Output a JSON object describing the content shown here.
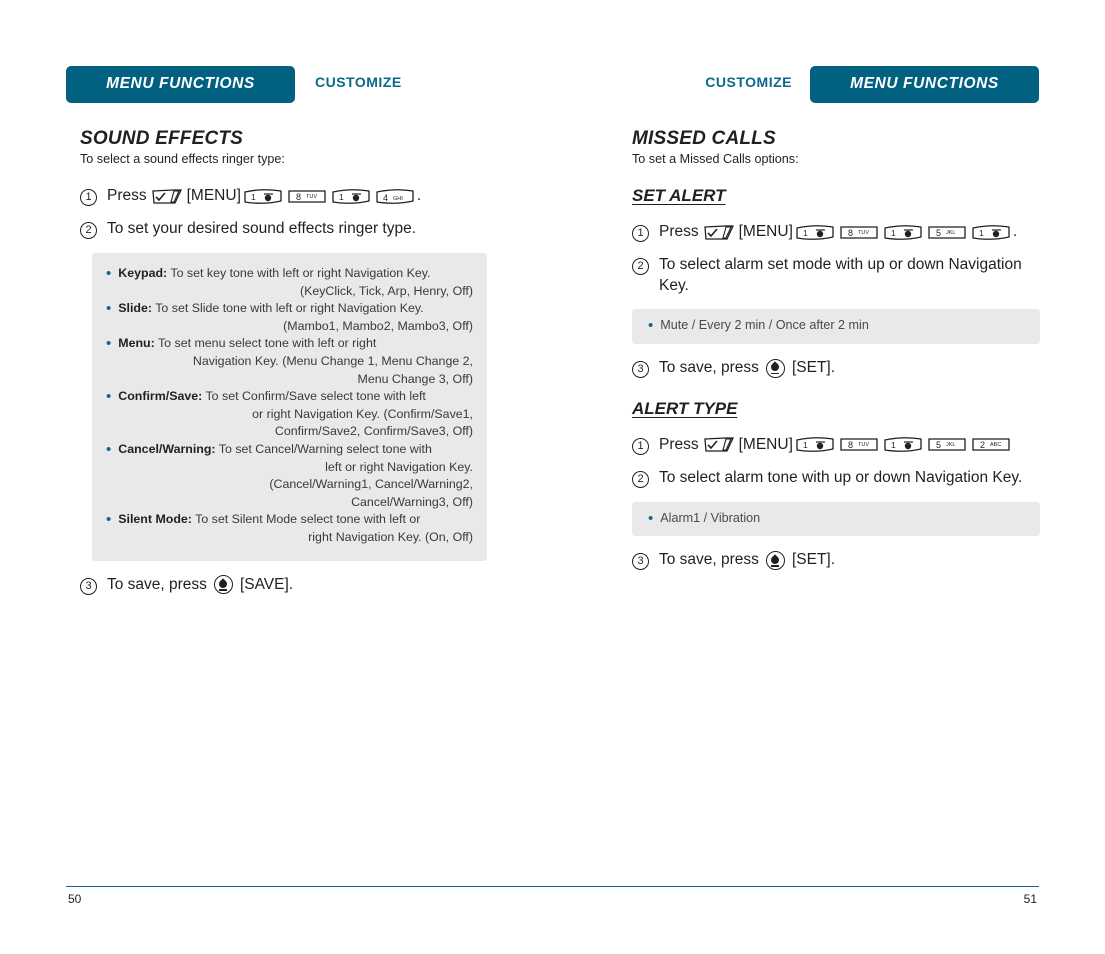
{
  "left_page": {
    "badge": "MENU FUNCTIONS",
    "section_tag": "CUSTOMIZE",
    "title": "SOUND EFFECTS",
    "lead": "To select a sound effects ringer type:",
    "step1": {
      "num": "1",
      "press_label": "Press",
      "menu_label": "[MENU]",
      "period": "."
    },
    "step1_keys": [
      {
        "digit": "1",
        "letters": ""
      },
      {
        "digit": "8",
        "letters": "TUV"
      },
      {
        "digit": "1",
        "letters": ""
      },
      {
        "digit": "4",
        "letters": "GHI"
      }
    ],
    "step2": {
      "num": "2",
      "text": "To set your desired sound effects ringer type."
    },
    "options": [
      {
        "term": "Keypad:",
        "text": "To set key tone with left or right Navigation Key.",
        "cont": [
          "(KeyClick, Tick, Arp, Henry, Off)"
        ]
      },
      {
        "term": "Slide:",
        "text": "To set Slide tone with left or right Navigation Key.",
        "cont": [
          "(Mambo1, Mambo2, Mambo3, Off)"
        ]
      },
      {
        "term": "Menu:",
        "text": "To set menu select tone with left or right",
        "cont": [
          "Navigation Key. (Menu Change 1, Menu Change 2,",
          "Menu Change 3, Off)"
        ]
      },
      {
        "term": "Confirm/Save:",
        "text": "To set Confirm/Save select tone with left",
        "cont": [
          "or right Navigation Key. (Confirm/Save1,",
          "Confirm/Save2, Confirm/Save3, Off)"
        ]
      },
      {
        "term": "Cancel/Warning:",
        "text": "To set Cancel/Warning select tone with",
        "cont": [
          "left or right Navigation Key.",
          "(Cancel/Warning1, Cancel/Warning2,",
          "Cancel/Warning3, Off)"
        ]
      },
      {
        "term": "Silent Mode:",
        "text": "To set Silent Mode select tone with left or",
        "cont": [
          "right Navigation Key. (On, Off)"
        ]
      }
    ],
    "step3": {
      "num": "3",
      "text_before": "To save, press",
      "text_after": "[SAVE]."
    },
    "page_number": "50"
  },
  "right_page": {
    "badge": "MENU FUNCTIONS",
    "section_tag": "CUSTOMIZE",
    "title": "MISSED CALLS",
    "lead": "To set a Missed Calls options:",
    "sub1": {
      "title": "SET ALERT",
      "step1": {
        "num": "1",
        "press_label": "Press",
        "menu_label": "[MENU]",
        "period": "."
      },
      "step1_keys": [
        {
          "digit": "1",
          "letters": ""
        },
        {
          "digit": "8",
          "letters": "TUV"
        },
        {
          "digit": "1",
          "letters": ""
        },
        {
          "digit": "5",
          "letters": "JKL"
        },
        {
          "digit": "1",
          "letters": ""
        }
      ],
      "step2": {
        "num": "2",
        "text": "To select alarm set mode with up or down Navigation Key."
      },
      "option": "Mute / Every 2 min / Once after 2 min",
      "step3": {
        "num": "3",
        "text_before": "To save, press",
        "text_after": "[SET]."
      }
    },
    "sub2": {
      "title": "ALERT TYPE",
      "step1": {
        "num": "1",
        "press_label": "Press",
        "menu_label": "[MENU]",
        "period": ""
      },
      "step1_keys": [
        {
          "digit": "1",
          "letters": ""
        },
        {
          "digit": "8",
          "letters": "TUV"
        },
        {
          "digit": "1",
          "letters": ""
        },
        {
          "digit": "5",
          "letters": "JKL"
        },
        {
          "digit": "2",
          "letters": "ABC"
        }
      ],
      "step2": {
        "num": "2",
        "text": "To select alarm tone with up or down Navigation Key."
      },
      "option": "Alarm1 / Vibration",
      "step3": {
        "num": "3",
        "text_before": "To save, press",
        "text_after": "[SET]."
      }
    },
    "page_number": "51"
  },
  "colors": {
    "teal": "#026081",
    "tag_teal": "#0a6a8c",
    "box_grey": "#e9e9e9",
    "ink": "#231f20"
  }
}
